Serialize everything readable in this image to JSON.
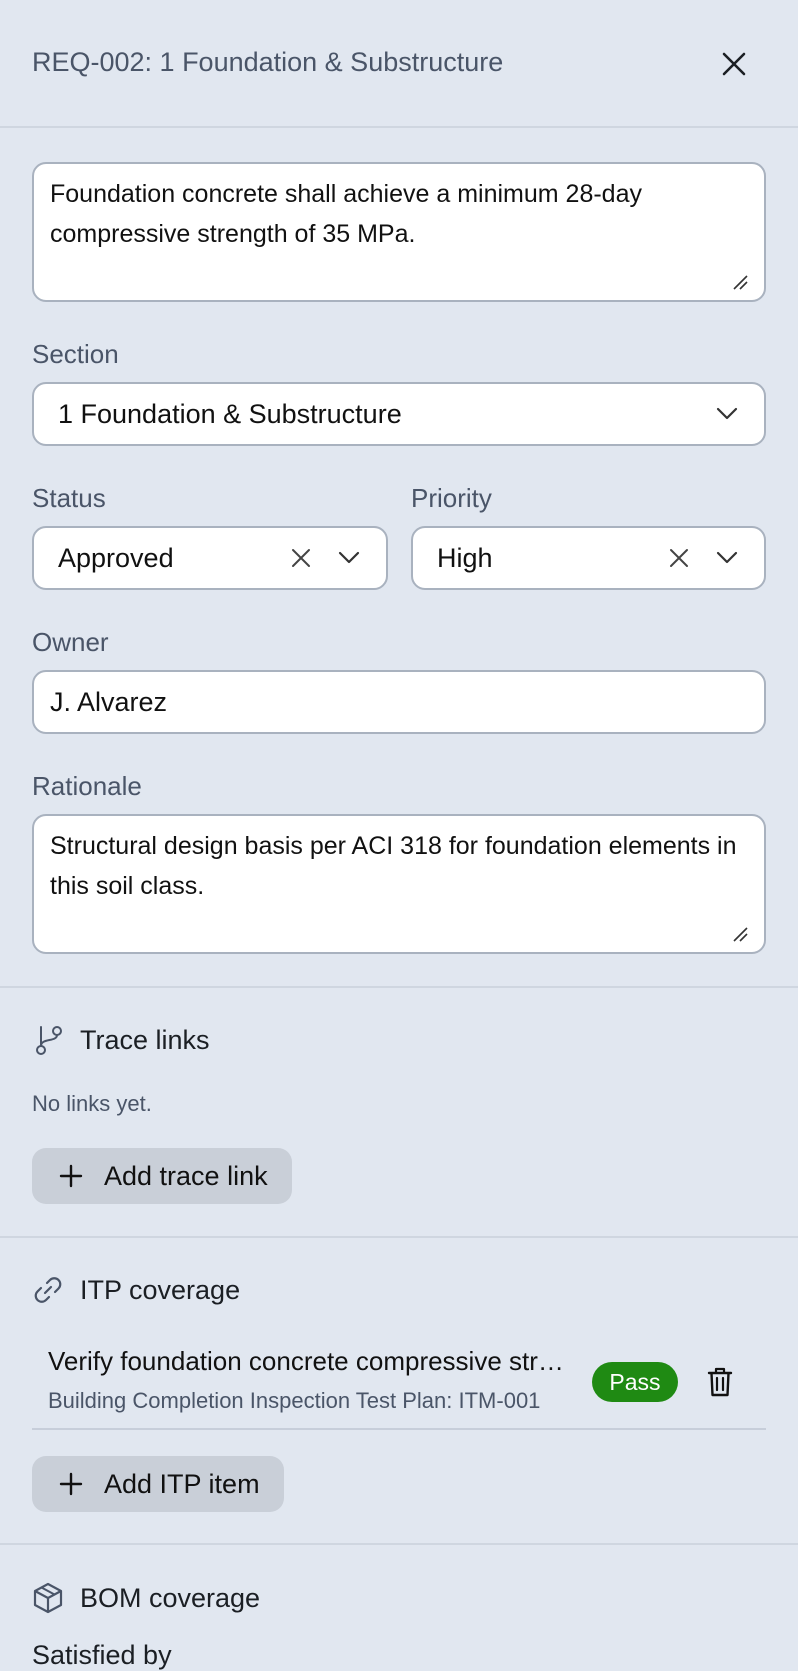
{
  "header": {
    "title": "REQ-002: 1 Foundation & Substructure",
    "close_icon": "close-icon"
  },
  "requirement": {
    "statement": "Foundation concrete shall achieve a minimum 28-day compressive strength of 35 MPa."
  },
  "section": {
    "label": "Section",
    "value": "1 Foundation & Substructure"
  },
  "status": {
    "label": "Status",
    "value": "Approved"
  },
  "priority": {
    "label": "Priority",
    "value": "High"
  },
  "owner": {
    "label": "Owner",
    "value": "J. Alvarez"
  },
  "rationale": {
    "label": "Rationale",
    "value": "Structural design basis per ACI 318 for foundation elements in this soil class."
  },
  "trace_links": {
    "title": "Trace links",
    "empty_text": "No links yet.",
    "add_label": "Add trace link",
    "icon": "git-branch-icon"
  },
  "itp_coverage": {
    "title": "ITP coverage",
    "icon": "link-icon",
    "items": [
      {
        "title": "Verify foundation concrete compressive strength",
        "subtitle": "Building Completion Inspection Test Plan: ITM-001",
        "status": "Pass"
      }
    ],
    "add_label": "Add ITP item"
  },
  "bom_coverage": {
    "title": "BOM coverage",
    "icon": "package-icon",
    "satisfied_by_label": "Satisfied by"
  },
  "colors": {
    "background": "#e1e7f0",
    "pass_badge": "#1f8a13",
    "button_bg": "#c9cfd8"
  }
}
